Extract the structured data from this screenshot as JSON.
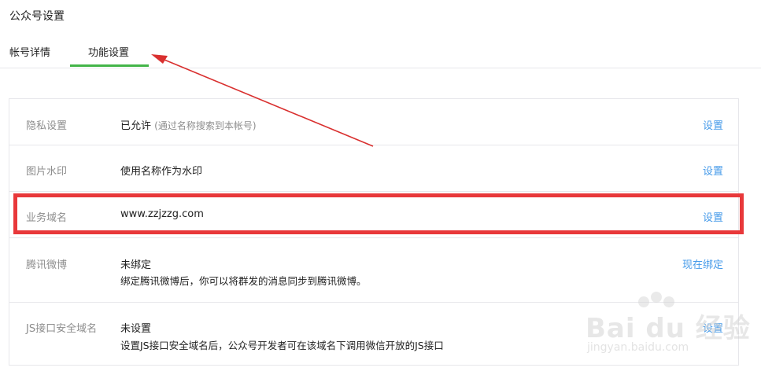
{
  "page": {
    "title": "公众号设置"
  },
  "tabs": [
    {
      "label": "帐号详情",
      "active": false
    },
    {
      "label": "功能设置",
      "active": true
    }
  ],
  "rows": [
    {
      "label": "隐私设置",
      "value": "已允许",
      "note": "(通过名称搜索到本帐号)",
      "action": "设置"
    },
    {
      "label": "图片水印",
      "value": "使用名称作为水印",
      "action": "设置"
    },
    {
      "label": "业务域名",
      "value": "www.zzjzzg.com",
      "action": "设置"
    },
    {
      "label": "腾讯微博",
      "value": "未绑定",
      "desc": "绑定腾讯微博后，你可以将群发的消息同步到腾讯微博。",
      "action": "现在绑定"
    },
    {
      "label": "JS接口安全域名",
      "value": "未设置",
      "desc": "设置JS接口安全域名后，公众号开发者可在该域名下调用微信开放的JS接口",
      "action": "设置"
    }
  ],
  "watermark": {
    "brand": "Bai du 经验",
    "site": "jingyan.baidu.com"
  },
  "colors": {
    "accent_green": "#44b549",
    "link_blue": "#459ae9",
    "annotation_red": "#e8383a"
  }
}
